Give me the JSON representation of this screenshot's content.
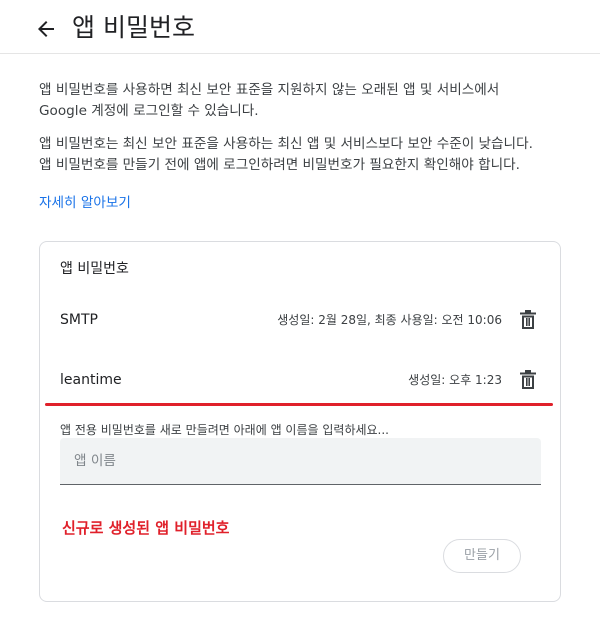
{
  "header": {
    "back_icon": "arrow-left-icon",
    "title": "앱 비밀번호"
  },
  "intro": {
    "paragraph1": "앱 비밀번호를 사용하면 최신 보안 표준을 지원하지 않는 오래된 앱 및 서비스에서 Google 계정에 로그인할 수 있습니다.",
    "paragraph2": "앱 비밀번호는 최신 보안 표준을 사용하는 최신 앱 및 서비스보다 보안 수준이 낮습니다. 앱 비밀번호를 만들기 전에 앱에 로그인하려면 비밀번호가 필요한지 확인해야 합니다.",
    "learn_more": "자세히 알아보기"
  },
  "card": {
    "title": "앱 비밀번호",
    "passwords": [
      {
        "name": "SMTP",
        "meta": "생성일: 2월 28일, 최종 사용일: 오전 10:06",
        "delete_icon": "trash-icon"
      },
      {
        "name": "leantime",
        "meta": "생성일: 오후 1:23",
        "delete_icon": "trash-icon"
      }
    ],
    "create_hint": "앱 전용 비밀번호를 새로 만들려면 아래에 앱 이름을 입력하세요...",
    "input_placeholder": "앱 이름",
    "input_value": "",
    "annotation": "신규로 생성된 앱 비밀번호",
    "create_button": "만들기"
  },
  "colors": {
    "link": "#1a73e8",
    "annotation_red": "#e0202a",
    "border": "#dadce0",
    "input_bg": "#f1f3f4"
  }
}
